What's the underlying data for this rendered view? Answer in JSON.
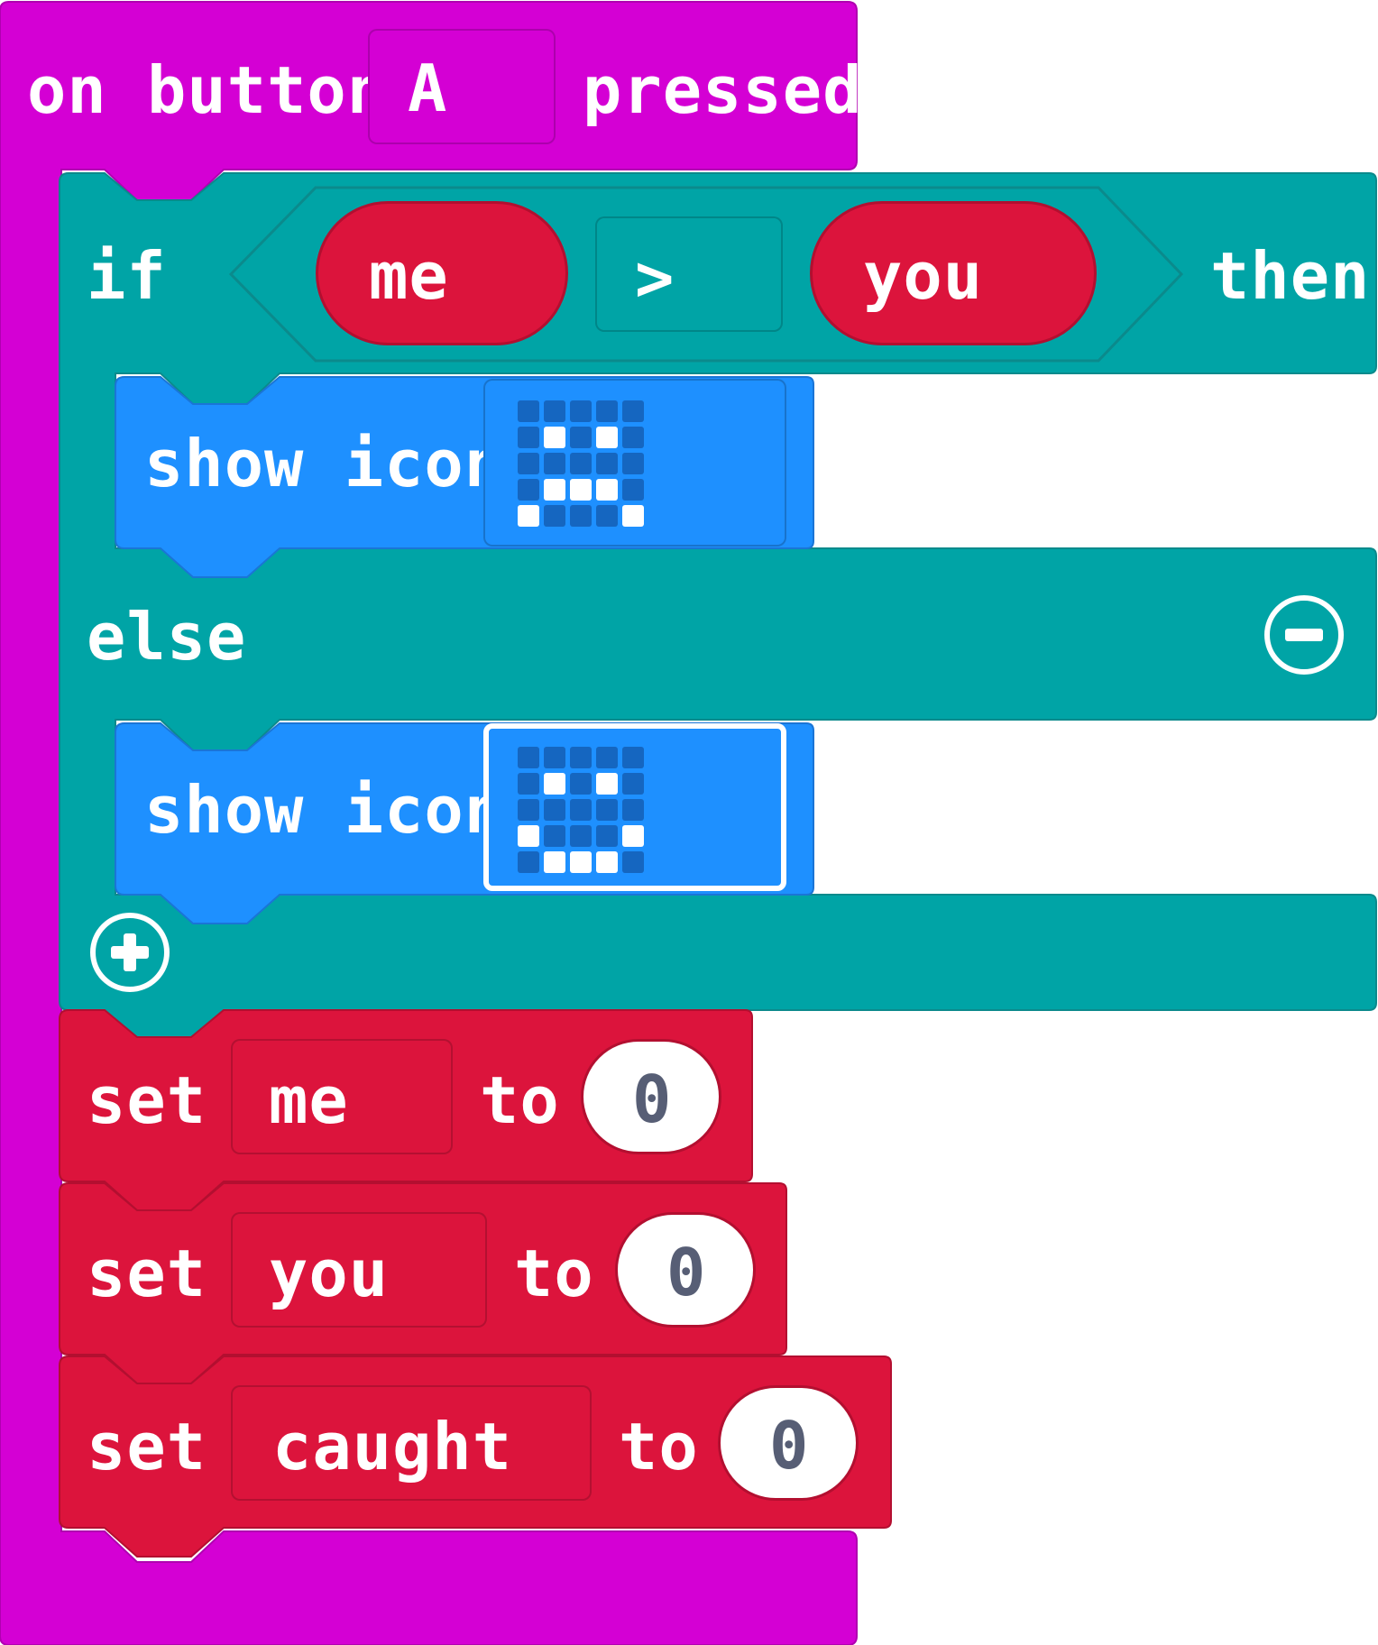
{
  "colors": {
    "event": "#d400d4",
    "logic": "#00a4a6",
    "basic": "#1e90ff",
    "variables": "#dc143c",
    "number_text": "#575e75"
  },
  "event_block": {
    "prefix": "on button",
    "button": "A",
    "suffix": "pressed"
  },
  "if_block": {
    "if_label": "if",
    "condition": {
      "left": "me",
      "operator": ">",
      "right": "you"
    },
    "then_label": "then",
    "else_label": "else",
    "remove_else_icon": "minus-circle-icon",
    "add_branch_icon": "plus-circle-icon"
  },
  "then_branch": {
    "label": "show icon",
    "icon_name": "happy-face-icon",
    "leds": [
      [
        0,
        0,
        0,
        0,
        0
      ],
      [
        0,
        1,
        0,
        1,
        0
      ],
      [
        0,
        0,
        0,
        0,
        0
      ],
      [
        0,
        1,
        1,
        1,
        0
      ],
      [
        1,
        0,
        0,
        0,
        1
      ]
    ]
  },
  "else_branch": {
    "label": "show icon",
    "icon_name": "sad-face-icon",
    "leds": [
      [
        0,
        0,
        0,
        0,
        0
      ],
      [
        0,
        1,
        0,
        1,
        0
      ],
      [
        0,
        0,
        0,
        0,
        0
      ],
      [
        1,
        0,
        0,
        0,
        1
      ],
      [
        0,
        1,
        1,
        1,
        0
      ]
    ]
  },
  "set_blocks": [
    {
      "set_label": "set",
      "variable": "me",
      "to_label": "to",
      "value": "0"
    },
    {
      "set_label": "set",
      "variable": "you",
      "to_label": "to",
      "value": "0"
    },
    {
      "set_label": "set",
      "variable": "caught",
      "to_label": "to",
      "value": "0"
    }
  ]
}
